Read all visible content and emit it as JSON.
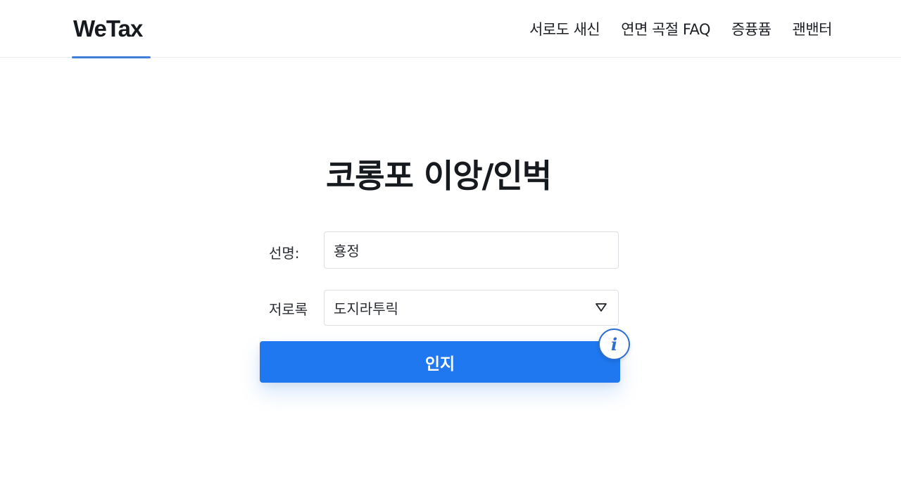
{
  "header": {
    "logo": "WeTax",
    "nav": [
      {
        "label": "서로도 새신"
      },
      {
        "label": "연면 곡절 FAQ"
      },
      {
        "label": "증퓽퓸"
      },
      {
        "label": "괜밴터"
      }
    ]
  },
  "form": {
    "title": "코롱포 이앙/인벅",
    "name_label": "선명:",
    "name_value": "횽정",
    "role_label": "저로록",
    "role_value": "도지라투릭",
    "submit_label": "인지"
  },
  "icons": {
    "info": "info-icon",
    "caret": "caret-down-icon"
  },
  "colors": {
    "accent": "#1f78ef",
    "info_ring": "#2d6fd0",
    "logo_underline": "#3f7fd9"
  }
}
